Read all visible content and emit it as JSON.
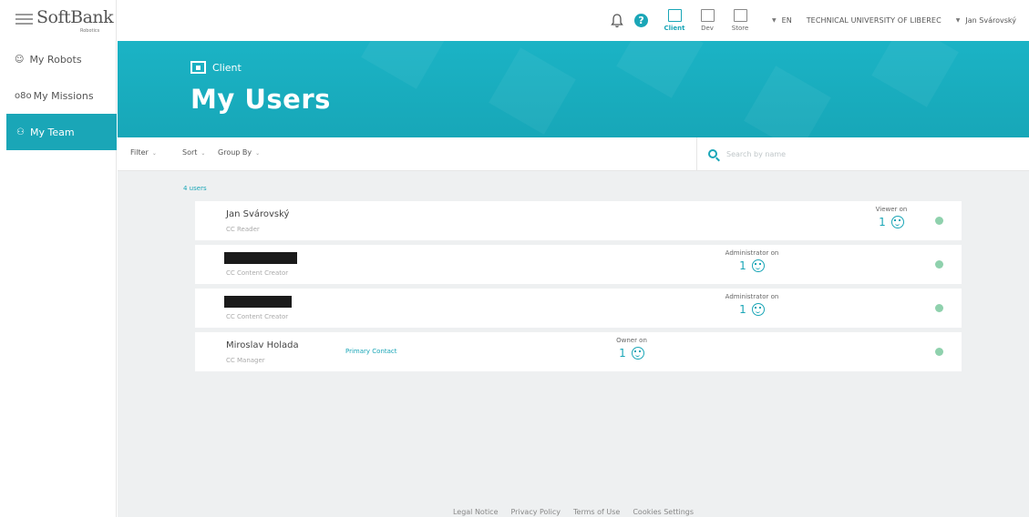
{
  "brand": {
    "name": "SoftBank",
    "sub": "Robotics"
  },
  "topbar": {
    "tools": [
      {
        "label": "Client",
        "active": true
      },
      {
        "label": "Dev",
        "active": false
      },
      {
        "label": "Store",
        "active": false
      }
    ],
    "language": "EN",
    "organization": "TECHNICAL UNIVERSITY OF LIBEREC",
    "user": "Jan Svárovský"
  },
  "sidebar": {
    "items": [
      {
        "label": "My Robots",
        "icon": "robot-face-icon",
        "active": false
      },
      {
        "label": "My Missions",
        "icon": "missions-icon",
        "active": false
      },
      {
        "label": "My Team",
        "icon": "team-icon",
        "active": true
      }
    ]
  },
  "hero": {
    "section": "Client",
    "title": "My Users"
  },
  "filters": {
    "filter": "Filter",
    "sort": "Sort",
    "group_by": "Group By"
  },
  "search": {
    "placeholder": "Search by name"
  },
  "users": {
    "count": "4 users",
    "rows": [
      {
        "name": "Jan Svárovský",
        "redacted": false,
        "role": "CC Reader",
        "primary": "",
        "perm_label": "Viewer on",
        "perm_count": "1"
      },
      {
        "name": "",
        "redacted": true,
        "role": "CC Content Creator",
        "primary": "",
        "perm_label": "Administrator on",
        "perm_count": "1"
      },
      {
        "name": "",
        "redacted": true,
        "role": "CC Content Creator",
        "primary": "",
        "perm_label": "Administrator on",
        "perm_count": "1"
      },
      {
        "name": "Miroslav Holada",
        "redacted": false,
        "role": "CC Manager",
        "primary": "Primary Contact",
        "perm_label": "Owner on",
        "perm_count": "1"
      }
    ]
  },
  "footer": {
    "links": [
      "Legal Notice",
      "Privacy Policy",
      "Terms of Use",
      "Cookies Settings"
    ]
  },
  "colors": {
    "accent": "#1aa6b7",
    "status_online": "#8fd1ad",
    "background": "#eef0f1"
  }
}
